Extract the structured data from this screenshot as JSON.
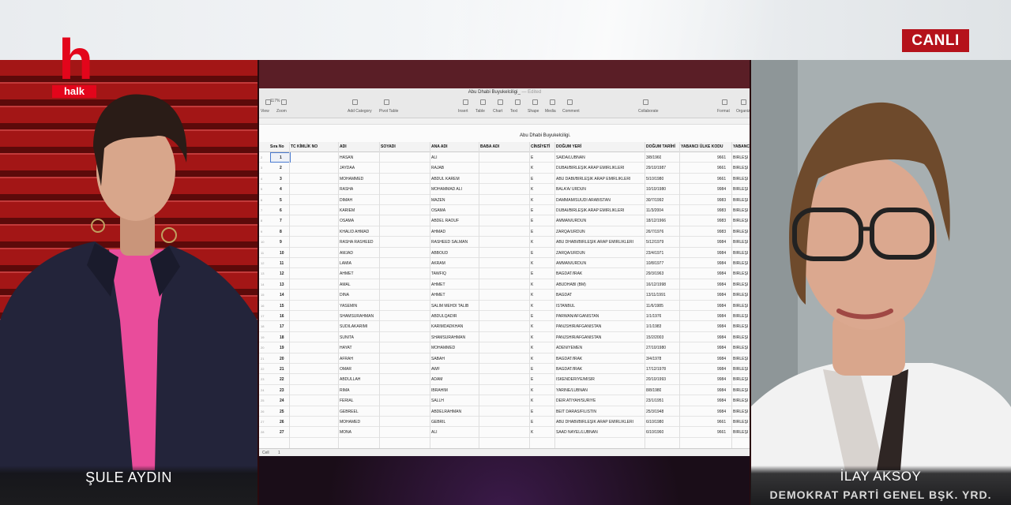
{
  "channel": {
    "logo_letter": "h",
    "logo_word": "halk",
    "live_label": "CANLI"
  },
  "left_panel": {
    "name": "ŞULE AYDIN"
  },
  "right_panel": {
    "name": "İLAY AKSOY",
    "role": "DEMOKRAT PARTİ GENEL BŞK. YRD."
  },
  "spreadsheet": {
    "window_title": "Abu Dhabi Buyukelciligi_",
    "window_subtitle": "— Edited",
    "zoom": "117%",
    "toolbar": [
      "View",
      "Zoom",
      "Add Category",
      "Pivot Table",
      "Insert",
      "Table",
      "Chart",
      "Text",
      "Shape",
      "Media",
      "Comment",
      "Collaborate",
      "Format",
      "Organize"
    ],
    "doc_title": "Abu Dhabi Buyukelciligi.",
    "headers": [
      "Sıra No",
      "TC KİMLİK NO",
      "ADI",
      "SOYADI",
      "ANA ADI",
      "BABA ADI",
      "CİNSİYETİ",
      "DOĞUM YERİ",
      "DOĞUM TARİHİ",
      "YABANCI ÜLKE KODU",
      "YABANCI"
    ],
    "rows": [
      {
        "no": "1",
        "adi": "HASAN",
        "ana": "ALİ",
        "cins": "E",
        "yer": "SAIDA/LÜBNAN",
        "tarih": "3/8/1960",
        "kod": "9661",
        "ulke": "BİRLEŞİ"
      },
      {
        "no": "2",
        "adi": "JAYDAA",
        "ana": "RAJAB",
        "cins": "K",
        "yer": "DUBAI/BİRLEŞİK ARAP EMİRLİKLERİ",
        "tarih": "29/10/1987",
        "kod": "9661",
        "ulke": "BİRLEŞİ"
      },
      {
        "no": "3",
        "adi": "MOHAMMED",
        "ana": "ABDUL KAREM",
        "cins": "E",
        "yer": "ABU DABİ/BİRLEŞİK ARAP EMİRLİKLERİ",
        "tarih": "5/10/1980",
        "kod": "9661",
        "ulke": "BİRLEŞİ"
      },
      {
        "no": "4",
        "adi": "RASHA",
        "ana": "MOHAMMAD ALİ",
        "cins": "K",
        "yer": "BALA'A/ ÜRDÜN",
        "tarih": "10/10/1980",
        "kod": "9984",
        "ulke": "BİRLEŞİ"
      },
      {
        "no": "5",
        "adi": "DIMAH",
        "ana": "MAZEN",
        "cins": "K",
        "yer": "DAMMAM/SUUDİ ARABİSTAN",
        "tarih": "30/7/1992",
        "kod": "9983",
        "ulke": "BİRLEŞİ"
      },
      {
        "no": "6",
        "adi": "KARIEM",
        "ana": "OSAMA",
        "cins": "E",
        "yer": "DUBAI/BİRLEŞİK ARAP EMİRLİKLERİ",
        "tarih": "11/3/2004",
        "kod": "9983",
        "ulke": "BİRLEŞİ"
      },
      {
        "no": "7",
        "adi": "OSAMA",
        "ana": "ABDEL RAOUF",
        "cins": "E",
        "yer": "AMMAN/ÜRDÜN",
        "tarih": "18/12/1966",
        "kod": "9983",
        "ulke": "BİRLEŞİ"
      },
      {
        "no": "8",
        "adi": "KHALID AHMAD",
        "ana": "AHMAD",
        "cins": "E",
        "yer": "ZARQA/ÜRDÜN",
        "tarih": "26/7/1976",
        "kod": "9983",
        "ulke": "BİRLEŞİ"
      },
      {
        "no": "9",
        "adi": "RASHA RASHEED",
        "ana": "RASHEED SALMAN",
        "cins": "K",
        "yer": "ABU DHABI/BİRLEŞİK ARAP EMİRLİKLERİ",
        "tarih": "5/12/1979",
        "kod": "9984",
        "ulke": "BİRLEŞİ"
      },
      {
        "no": "10",
        "adi": "AMJAD",
        "ana": "ABBOUD",
        "cins": "E",
        "yer": "ZARQA/ÜRDÜN",
        "tarih": "23/4/1971",
        "kod": "9984",
        "ulke": "BİRLEŞİ"
      },
      {
        "no": "11",
        "adi": "LAMIA",
        "ana": "AKRAM",
        "cins": "K",
        "yer": "AMMAN/ÜRDÜN",
        "tarih": "10/8/1977",
        "kod": "9984",
        "ulke": "BİRLEŞİ"
      },
      {
        "no": "12",
        "adi": "AHMET",
        "ana": "TAWFIQ",
        "cins": "E",
        "yer": "BAĞDAT/IRAK",
        "tarih": "29/3/1963",
        "kod": "9984",
        "ulke": "BİRLEŞİ"
      },
      {
        "no": "13",
        "adi": "AMAL",
        "ana": "AHMET",
        "cins": "K",
        "yer": "ABUDHABİ (BM)",
        "tarih": "16/12/1998",
        "kod": "9984",
        "ulke": "BİRLEŞİ"
      },
      {
        "no": "14",
        "adi": "DİNA",
        "ana": "AHMET",
        "cins": "K",
        "yer": "BAĞDAT",
        "tarih": "13/11/1991",
        "kod": "9984",
        "ulke": "BİRLEŞİ"
      },
      {
        "no": "15",
        "adi": "YASEMİN",
        "ana": "SALİM MEHDİ TALİB",
        "cins": "K",
        "yer": "İSTANBUL",
        "tarih": "11/6/1985",
        "kod": "9984",
        "ulke": "BİRLEŞİ"
      },
      {
        "no": "16",
        "adi": "SHAMSURAHMAN",
        "ana": "ABDULQADIR",
        "cins": "E",
        "yer": "PARWAN/AFGANİSTAN",
        "tarih": "1/1/1976",
        "kod": "9984",
        "ulke": "BİRLEŞİ"
      },
      {
        "no": "17",
        "adi": "SUDILAKARIMI",
        "ana": "KARIMDADKHAN",
        "cins": "K",
        "yer": "PANJSHIR/AFGANİSTAN",
        "tarih": "1/1/1983",
        "kod": "9984",
        "ulke": "BİRLEŞİ"
      },
      {
        "no": "18",
        "adi": "SUNITA",
        "ana": "SHAMSURAHMAN",
        "cins": "K",
        "yer": "PANJSHIR/AFGANİSTAN",
        "tarih": "15/2/2003",
        "kod": "9984",
        "ulke": "BİRLEŞİ"
      },
      {
        "no": "19",
        "adi": "HAYAT",
        "ana": "MOHAMMED",
        "cins": "K",
        "yer": "ADEN/YEMEN",
        "tarih": "27/10/1980",
        "kod": "9984",
        "ulke": "BİRLEŞİ"
      },
      {
        "no": "20",
        "adi": "AFRAH",
        "ana": "SABAH",
        "cins": "K",
        "yer": "BAĞDAT/IRAK",
        "tarih": "3/4/1978",
        "kod": "9984",
        "ulke": "BİRLEŞİ"
      },
      {
        "no": "21",
        "adi": "OMAR",
        "ana": "AWF",
        "cins": "E",
        "yer": "BAĞDAT/IRAK",
        "tarih": "17/12/1978",
        "kod": "9984",
        "ulke": "BİRLEŞİ"
      },
      {
        "no": "22",
        "adi": "ABDULLAH",
        "ana": "ADAM",
        "cins": "E",
        "yer": "İSKENDERİYE/MISIR",
        "tarih": "20/10/1993",
        "kod": "9984",
        "ulke": "BİRLEŞİ"
      },
      {
        "no": "23",
        "adi": "RIMA",
        "ana": "IBRAHIM",
        "cins": "K",
        "yer": "YARİNE/LÜBNAN",
        "tarih": "8/8/1980",
        "kod": "9984",
        "ulke": "BİRLEŞİ"
      },
      {
        "no": "24",
        "adi": "FERIAL",
        "ana": "SALLH",
        "cins": "K",
        "yer": "DEIR ATIYAH/SURİYE",
        "tarih": "23/1/1951",
        "kod": "9984",
        "ulke": "BİRLEŞİ"
      },
      {
        "no": "25",
        "adi": "GEBREEL",
        "ana": "ABDELRAHMAN",
        "cins": "E",
        "yer": "BEIT DARAS/FİLİSTİN",
        "tarih": "25/3/1948",
        "kod": "9984",
        "ulke": "BİRLEŞİ"
      },
      {
        "no": "26",
        "adi": "MOHAMED",
        "ana": "GEBRIL",
        "cins": "E",
        "yer": "ABU DHABI/BİRLEŞİK ARAP EMİRLİKLERİ",
        "tarih": "6/10/1980",
        "kod": "9661",
        "ulke": "BİRLEŞİ"
      },
      {
        "no": "27",
        "adi": "MONA",
        "ana": "ALİ",
        "cins": "K",
        "yer": "SAAD NAYEL/LÜBNAN",
        "tarih": "6/10/1960",
        "kod": "9661",
        "ulke": "BİRLEŞİ"
      }
    ],
    "status_value": "1"
  }
}
